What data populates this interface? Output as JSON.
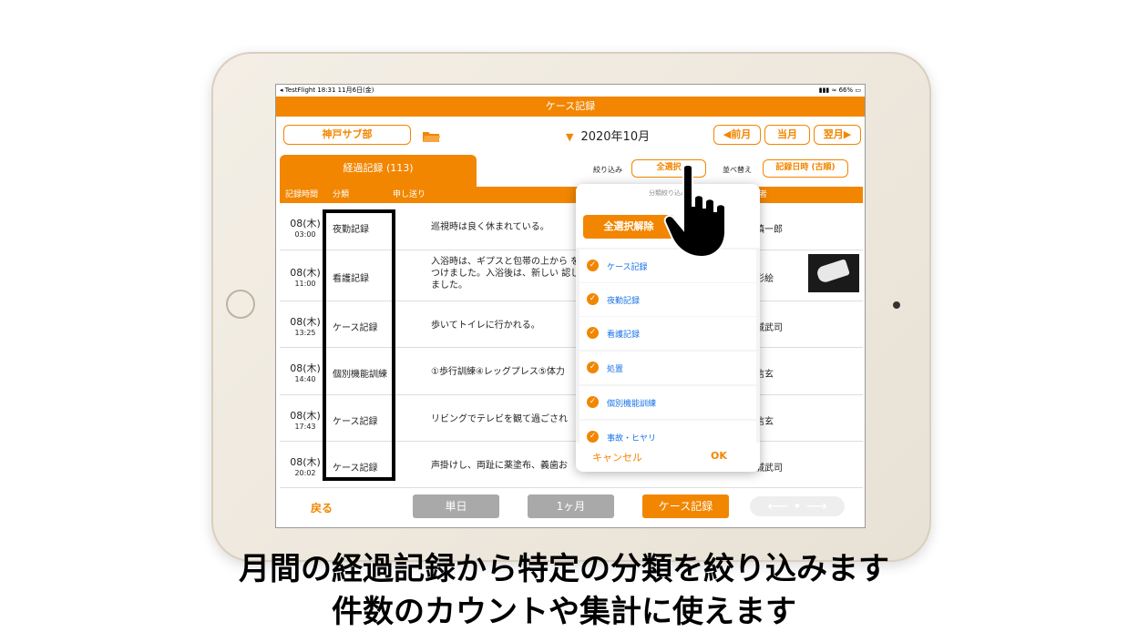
{
  "status": {
    "left": "◂ TestFlight   18:31   11月6日(金)",
    "right": "▮▮▮ ≈ 66% ▭"
  },
  "nav": {
    "title": "ケース記録"
  },
  "toolbar": {
    "facility": "神戸サブ部",
    "month": "2020年10月",
    "prev": "◀前月",
    "current": "当月",
    "next": "翌月▶"
  },
  "tab": {
    "label": "経過記録 (113)"
  },
  "filter": {
    "label": "絞り込み",
    "button": "全選択",
    "sort_label": "並べ替え",
    "sort_button": "記録日時 (古順)"
  },
  "table": {
    "headers": {
      "time": "記録時間",
      "category": "分類",
      "memo": "申し送り",
      "person": "者"
    },
    "rows": [
      {
        "date": "08(木)",
        "time": "03:00",
        "category": "夜勤記録",
        "memo": "巡視時は良く休まれている。",
        "person": "慎一郎"
      },
      {
        "date": "08(木)",
        "time": "11:00",
        "category": "看護記録",
        "memo": "入浴時は、ギプスと包帯の上から をつけました。入浴後は、新しい 認しました。",
        "person": "彩絵"
      },
      {
        "date": "08(木)",
        "time": "13:25",
        "category": "ケース記録",
        "memo": "歩いてトイレに行かれる。",
        "person": "城武司"
      },
      {
        "date": "08(木)",
        "time": "14:40",
        "category": "個別機能訓練",
        "memo": "①歩行訓練④レッグプレス⑤体力",
        "person": "信玄"
      },
      {
        "date": "08(木)",
        "time": "17:43",
        "category": "ケース記録",
        "memo": "リビングでテレビを観て過ごされ",
        "person": "信玄"
      },
      {
        "date": "08(木)",
        "time": "20:02",
        "category": "ケース記録",
        "memo": "声掛けし、両趾に薬塗布、義歯お",
        "person": "城武司"
      }
    ]
  },
  "popup": {
    "title": "分類絞り込み",
    "clear_all": "全選択解除",
    "items": [
      "ケース記録",
      "夜勤記録",
      "看護記録",
      "処置",
      "個別機能訓練",
      "事故・ヒヤリ"
    ],
    "cancel": "キャンセル",
    "ok": "OK"
  },
  "bottom": {
    "back": "戻る",
    "single": "単日",
    "month": "1ヶ月",
    "case": "ケース記録"
  },
  "caption": {
    "line1": "月間の経過記録から特定の分類を絞り込みます",
    "line2": "件数のカウントや集計に使えます"
  },
  "colors": {
    "accent": "#f28600",
    "gray_button": "#a9a9a9",
    "link": "#1a73e8"
  }
}
